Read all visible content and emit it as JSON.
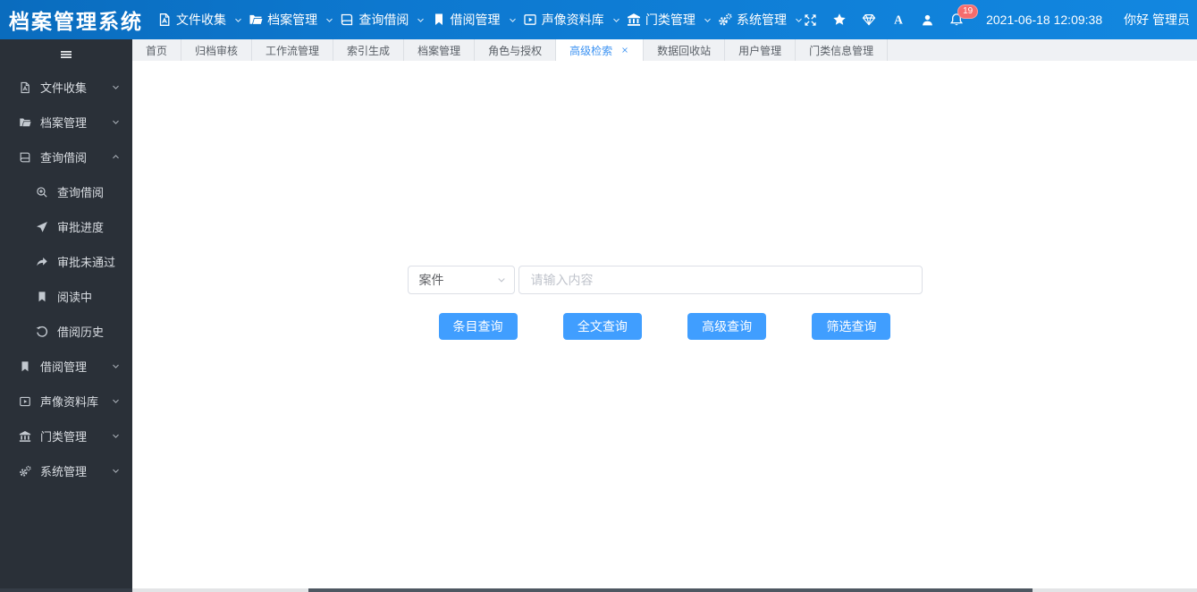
{
  "app": {
    "title": "档案管理系统"
  },
  "topnav": {
    "menus": [
      {
        "label": "文件收集",
        "icon": "file-icon"
      },
      {
        "label": "档案管理",
        "icon": "folder-open-icon"
      },
      {
        "label": "查询借阅",
        "icon": "book-icon"
      },
      {
        "label": "借阅管理",
        "icon": "bookmark-icon"
      },
      {
        "label": "声像资料库",
        "icon": "media-icon"
      },
      {
        "label": "门类管理",
        "icon": "bank-icon"
      },
      {
        "label": "系统管理",
        "icon": "gears-icon"
      }
    ],
    "utility_icons": [
      "expand-icon",
      "star-icon",
      "gem-icon",
      "font-size-icon",
      "user-icon",
      "bell-icon"
    ],
    "badge_count": "19",
    "datetime": "2021-06-18 12:09:38",
    "greeting": "你好 管理员"
  },
  "sidebar": {
    "items": [
      {
        "label": "文件收集",
        "icon": "file-icon",
        "expanded": false
      },
      {
        "label": "档案管理",
        "icon": "folder-open-icon",
        "expanded": false
      },
      {
        "label": "查询借阅",
        "icon": "book-icon",
        "expanded": true,
        "children": [
          {
            "label": "查询借阅",
            "icon": "search-plus-icon"
          },
          {
            "label": "审批进度",
            "icon": "send-icon"
          },
          {
            "label": "审批未通过",
            "icon": "redo-arrow-icon"
          },
          {
            "label": "阅读中",
            "icon": "bookmark-icon"
          },
          {
            "label": "借阅历史",
            "icon": "history-icon"
          }
        ]
      },
      {
        "label": "借阅管理",
        "icon": "bookmark-icon",
        "expanded": false
      },
      {
        "label": "声像资料库",
        "icon": "media-icon",
        "expanded": false
      },
      {
        "label": "门类管理",
        "icon": "bank-icon",
        "expanded": false
      },
      {
        "label": "系统管理",
        "icon": "gears-icon",
        "expanded": false
      }
    ]
  },
  "tabs": {
    "items": [
      {
        "label": "首页",
        "active": false
      },
      {
        "label": "归档审核",
        "active": false
      },
      {
        "label": "工作流管理",
        "active": false
      },
      {
        "label": "索引生成",
        "active": false
      },
      {
        "label": "档案管理",
        "active": false
      },
      {
        "label": "角色与授权",
        "active": false
      },
      {
        "label": "高级检索",
        "active": true,
        "closable": true
      },
      {
        "label": "数据回收站",
        "active": false
      },
      {
        "label": "用户管理",
        "active": false
      },
      {
        "label": "门类信息管理",
        "active": false
      }
    ]
  },
  "search": {
    "select_value": "案件",
    "input_placeholder": "请输入内容",
    "buttons": [
      "条目查询",
      "全文查询",
      "高级查询",
      "筛选查询"
    ]
  },
  "colors": {
    "header_blue_left": "#0a6cbe",
    "header_blue_right": "#1287e0",
    "sidebar_bg": "#2a3038",
    "primary_button": "#409eff",
    "badge_red": "#f56c6c",
    "tabbar_bg": "#eff1f4",
    "active_tab_text": "#3d93f2",
    "input_border": "#dcdfe6",
    "placeholder_gray": "#c0c4cc"
  }
}
